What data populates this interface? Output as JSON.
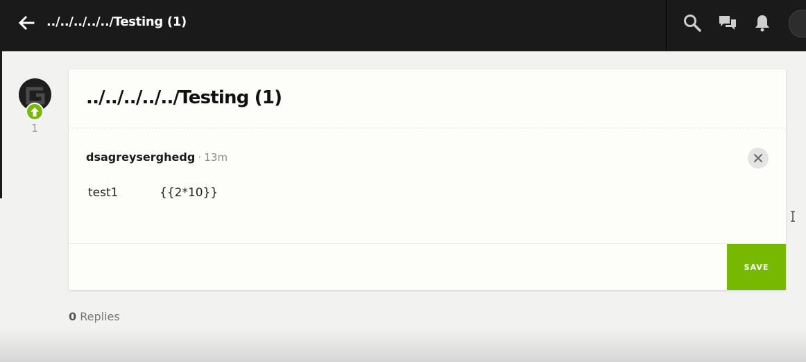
{
  "header": {
    "title": "../../../../../Testing (1)",
    "icons": [
      "back-arrow-icon",
      "search-icon",
      "chat-icon",
      "bell-icon",
      "user-avatar"
    ]
  },
  "post": {
    "vote_count": "1",
    "title": "../../../../../Testing (1)"
  },
  "comment": {
    "author": "dsagreyserghedg",
    "separator": "·",
    "time": "13m",
    "body_col1": "test1",
    "body_col2": "{{2*10}}"
  },
  "editor": {
    "save_label": "SAVE"
  },
  "replies": {
    "count": "0",
    "label": "Replies"
  },
  "colors": {
    "accent": "#76b900",
    "topbar": "#1a1a1a",
    "background": "#f2f2f0",
    "card": "#fdfdfa"
  }
}
